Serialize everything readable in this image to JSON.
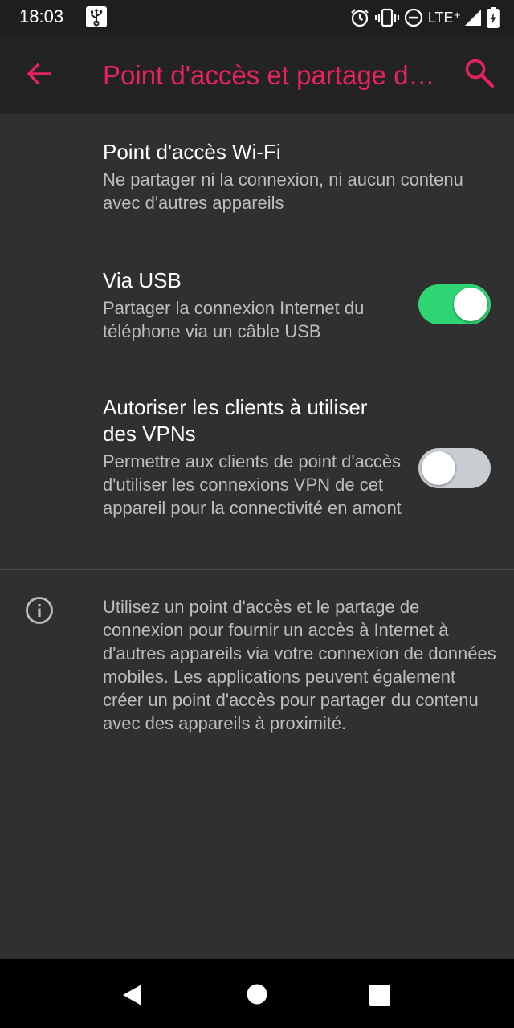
{
  "status_bar": {
    "time": "18:03",
    "network": "LTE⁺",
    "icons": [
      "usb-icon",
      "alarm-icon",
      "vibrate-icon",
      "do-not-disturb-icon",
      "signal-icon",
      "battery-charging-icon"
    ]
  },
  "app_bar": {
    "title": "Point d'accès et partage de connexion",
    "back_icon": "arrow-back-icon",
    "search_icon": "search-icon"
  },
  "preferences": [
    {
      "title": "Point d'accès Wi-Fi",
      "summary": "Ne partager ni la connexion, ni aucun contenu avec d'autres appareils",
      "has_toggle": false
    },
    {
      "title": "Via USB",
      "summary": "Partager la connexion Internet du téléphone via un câble USB",
      "has_toggle": true,
      "checked": true
    },
    {
      "title": "Autoriser les clients à utiliser des VPNs",
      "summary": "Permettre aux clients de point d'accès d'utiliser les connexions VPN de cet appareil pour la connectivité en amont",
      "has_toggle": true,
      "checked": false
    }
  ],
  "footer_info": {
    "icon": "info-icon",
    "text": "Utilisez un point d'accès et le partage de connexion pour fournir un accès à Internet à d'autres appareils via votre connexion de données mobiles. Les applications peuvent également créer un point d'accès pour partager du contenu avec des appareils à proximité."
  },
  "nav_bar": {
    "icons": [
      "nav-back-icon",
      "nav-home-icon",
      "nav-recents-icon"
    ]
  },
  "colors": {
    "accent": "#e5235d",
    "background": "#303030",
    "app_bar": "#232323",
    "status_bar": "#1e1e1e",
    "toggle_on_track": "#2ed573",
    "toggle_off_track": "#c8cdd2"
  }
}
